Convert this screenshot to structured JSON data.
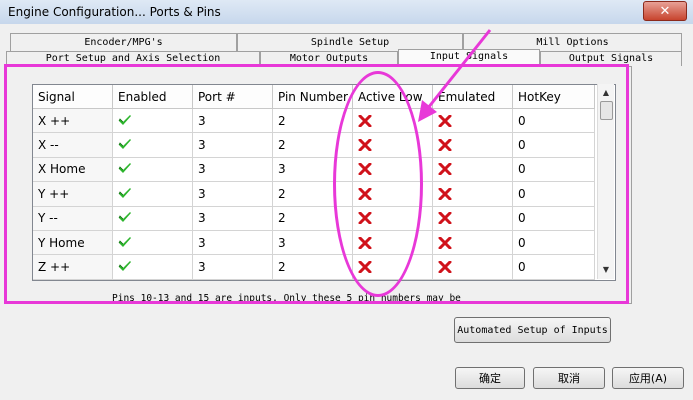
{
  "window": {
    "title": "Engine Configuration... Ports & Pins",
    "close_glyph": "✕"
  },
  "tabs": {
    "row1": [
      "Encoder/MPG's",
      "Spindle Setup",
      "Mill Options"
    ],
    "row2": [
      "Port Setup and Axis Selection",
      "Motor Outputs",
      "Input Signals",
      "Output Signals"
    ],
    "active": "Input Signals"
  },
  "table": {
    "columns": [
      "Signal",
      "Enabled",
      "Port #",
      "Pin Number",
      "Active Low",
      "Emulated",
      "HotKey"
    ],
    "rows": [
      {
        "signal": "X ++",
        "enabled": "green-check-icon",
        "port": "3",
        "pin": "2",
        "active_low": "red-x-icon",
        "emulated": "red-x-icon",
        "hotkey": "0"
      },
      {
        "signal": "X --",
        "enabled": "green-check-icon",
        "port": "3",
        "pin": "2",
        "active_low": "red-x-icon",
        "emulated": "red-x-icon",
        "hotkey": "0"
      },
      {
        "signal": "X Home",
        "enabled": "green-check-icon",
        "port": "3",
        "pin": "3",
        "active_low": "red-x-icon",
        "emulated": "red-x-icon",
        "hotkey": "0"
      },
      {
        "signal": "Y ++",
        "enabled": "green-check-icon",
        "port": "3",
        "pin": "2",
        "active_low": "red-x-icon",
        "emulated": "red-x-icon",
        "hotkey": "0"
      },
      {
        "signal": "Y --",
        "enabled": "green-check-icon",
        "port": "3",
        "pin": "2",
        "active_low": "red-x-icon",
        "emulated": "red-x-icon",
        "hotkey": "0"
      },
      {
        "signal": "Y Home",
        "enabled": "green-check-icon",
        "port": "3",
        "pin": "3",
        "active_low": "red-x-icon",
        "emulated": "red-x-icon",
        "hotkey": "0"
      },
      {
        "signal": "Z ++",
        "enabled": "green-check-icon",
        "port": "3",
        "pin": "2",
        "active_low": "red-x-icon",
        "emulated": "red-x-icon",
        "hotkey": "0"
      }
    ]
  },
  "note": "Pins 10-13 and 15 are inputs. Only these 5 pin numbers may be",
  "buttons": {
    "automated_setup": "Automated Setup of Inputs",
    "ok": "确定",
    "cancel": "取消",
    "apply": "应用(A)"
  },
  "colors": {
    "annotation": "#e838d8",
    "check": "#2db52d",
    "cross": "#d0121b"
  }
}
